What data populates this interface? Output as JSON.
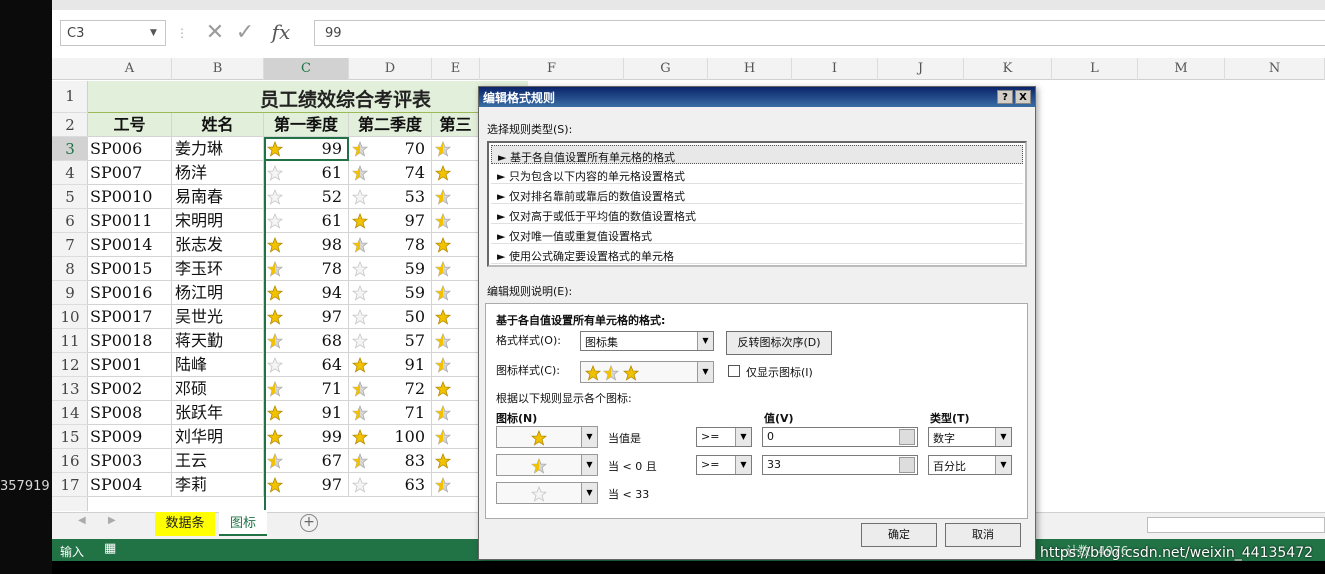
{
  "side_text": "357919",
  "formula_bar": {
    "name_box": "C3",
    "fx_label": "fx",
    "value": "99"
  },
  "columns": [
    "A",
    "B",
    "C",
    "D",
    "E",
    "F",
    "G",
    "H",
    "I",
    "J",
    "K",
    "L",
    "M",
    "N"
  ],
  "rows": [
    "1",
    "2",
    "3",
    "4",
    "5",
    "6",
    "7",
    "8",
    "9",
    "10",
    "11",
    "12",
    "13",
    "14",
    "15",
    "16",
    "17"
  ],
  "sheet": {
    "title": "员工绩效综合考评表",
    "headers": [
      "工号",
      "姓名",
      "第一季度",
      "第二季度",
      "第三"
    ],
    "data": [
      {
        "id": "SP006",
        "name": "姜力琳",
        "q1": "99",
        "q2": "70"
      },
      {
        "id": "SP007",
        "name": "杨洋",
        "q1": "61",
        "q2": "74"
      },
      {
        "id": "SP0010",
        "name": "易南春",
        "q1": "52",
        "q2": "53"
      },
      {
        "id": "SP0011",
        "name": "宋明明",
        "q1": "61",
        "q2": "97"
      },
      {
        "id": "SP0014",
        "name": "张志发",
        "q1": "98",
        "q2": "78"
      },
      {
        "id": "SP0015",
        "name": "李玉环",
        "q1": "78",
        "q2": "59"
      },
      {
        "id": "SP0016",
        "name": "杨江明",
        "q1": "94",
        "q2": "59"
      },
      {
        "id": "SP0017",
        "name": "吴世光",
        "q1": "97",
        "q2": "50"
      },
      {
        "id": "SP0018",
        "name": "蒋天勤",
        "q1": "68",
        "q2": "57"
      },
      {
        "id": "SP001",
        "name": "陆峰",
        "q1": "64",
        "q2": "91"
      },
      {
        "id": "SP002",
        "name": "邓硕",
        "q1": "71",
        "q2": "72"
      },
      {
        "id": "SP008",
        "name": "张跃年",
        "q1": "91",
        "q2": "71"
      },
      {
        "id": "SP009",
        "name": "刘华明",
        "q1": "99",
        "q2": "100"
      },
      {
        "id": "SP003",
        "name": "王云",
        "q1": "67",
        "q2": "83"
      },
      {
        "id": "SP004",
        "name": "李莉",
        "q1": "97",
        "q2": "63"
      }
    ]
  },
  "tabs": [
    "数据条",
    "图标"
  ],
  "status": {
    "mode": "输入",
    "stat": "计数: 4976"
  },
  "watermark": "https://blog.csdn.net/weixin_44135472",
  "dialog": {
    "title": "编辑格式规则",
    "help": "?",
    "close": "X",
    "rule_type_label": "选择规则类型(S):",
    "rule_types": [
      "► 基于各自值设置所有单元格的格式",
      "► 只为包含以下内容的单元格设置格式",
      "► 仅对排名靠前或靠后的数值设置格式",
      "► 仅对高于或低于平均值的数值设置格式",
      "► 仅对唯一值或重复值设置格式",
      "► 使用公式确定要设置格式的单元格"
    ],
    "desc_label": "编辑规则说明(E):",
    "desc_heading": "基于各自值设置所有单元格的格式:",
    "format_style_label": "格式样式(O):",
    "format_style_value": "图标集",
    "reverse_button": "反转图标次序(D)",
    "icon_style_label": "图标样式(C):",
    "show_icon_only": "仅显示图标(I)",
    "rules_caption": "根据以下规则显示各个图标:",
    "col_icon": "图标(N)",
    "col_value": "值(V)",
    "col_type": "类型(T)",
    "icon_rules": [
      {
        "when": "当值是",
        "op": ">=",
        "value": "0",
        "type": "数字"
      },
      {
        "when": "当 < 0 且",
        "op": ">=",
        "value": "33",
        "type": "百分比"
      },
      {
        "when": "当 < 33",
        "op": "",
        "value": "",
        "type": ""
      }
    ],
    "ok": "确定",
    "cancel": "取消"
  },
  "colors": {
    "accent": "#217346",
    "header_fill": "#e2efda",
    "star_gold": "#f2c200",
    "star_empty": "#d6d6d6"
  },
  "icon_levels": [
    "full",
    "half",
    "empty"
  ]
}
